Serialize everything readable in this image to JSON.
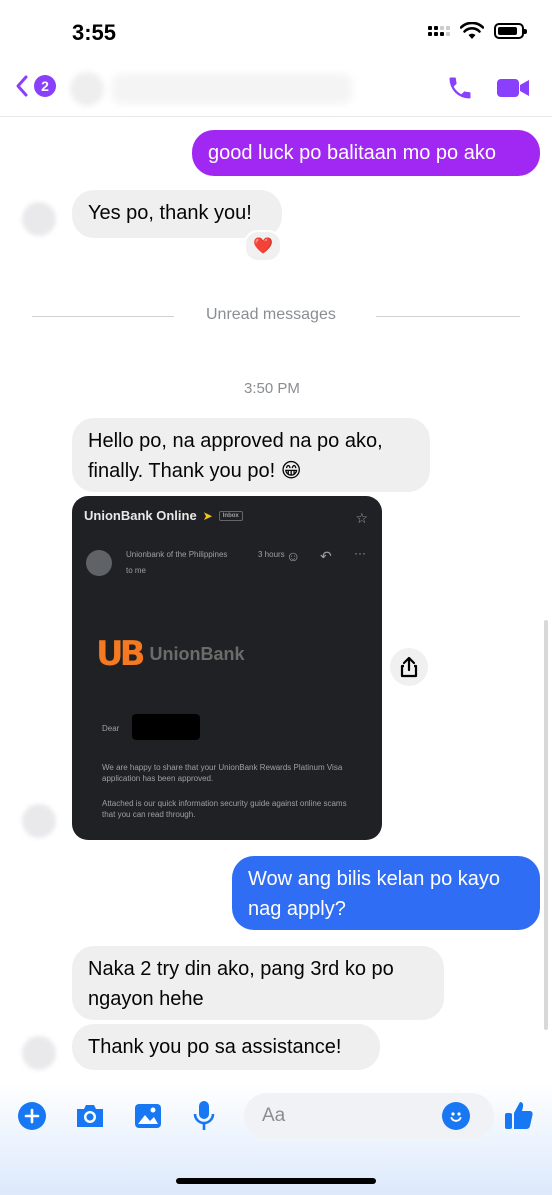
{
  "status_bar": {
    "time": "3:55"
  },
  "header": {
    "unread_count": "2"
  },
  "messages": {
    "sent_1": "good luck po balitaan mo po ako",
    "recv_1": "Yes po, thank you!",
    "reaction_1": "❤️",
    "unread_separator": "Unread messages",
    "timestamp": "3:50 PM",
    "recv_2": "Hello po, na approved na po ako, finally. Thank you po! 😁",
    "sent_2": "Wow ang bilis kelan po kayo nag apply?",
    "recv_3": "Naka 2 try din ako, pang 3rd ko po ngayon hehe",
    "recv_4": "Thank you po sa assistance!"
  },
  "attachment": {
    "app_title": "UnionBank Online",
    "inbox_tag": "Inbox",
    "sender": "Unionbank of the Philippines",
    "sender_time": "3 hours",
    "to_me": "to me",
    "brand": "UnionBank",
    "greeting": "Dear",
    "body_1": "We are happy to share that your UnionBank Rewards Platinum Visa application has been approved.",
    "body_2": "Attached is our quick information security guide against online scams that you can read through."
  },
  "composer": {
    "placeholder": "Aa"
  },
  "colors": {
    "purple": "#a128f3",
    "blue": "#2f6df5",
    "accent_icon": "#8a3ffc",
    "composer_icon": "#1877f2"
  }
}
